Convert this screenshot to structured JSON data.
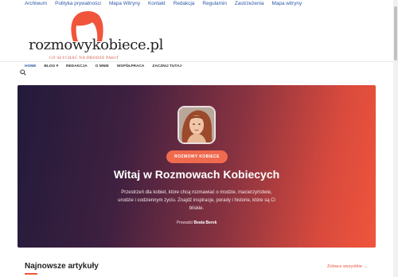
{
  "topbar": {
    "links": [
      "Archiwum",
      "Polityka prywatności",
      "Mapa Witryny",
      "Kontakt",
      "Redakcja",
      "Regulamin",
      "Zastrzeżenia",
      "Mapa witryny"
    ]
  },
  "logo": {
    "name": "rozmowykobiece.pl",
    "tagline": "CO SŁYCHAĆ NA DRODZE PAKIT"
  },
  "nav": {
    "items": [
      "HOME",
      "BLOG ▾",
      "REDAKCJA",
      "O MNIE",
      "WSPÓŁPRACA",
      "ZACZNIJ TUTAJ"
    ],
    "search_icon": "search-icon"
  },
  "hero": {
    "badge": "ROZMOWY KOBIECE",
    "title": "Witaj w Rozmowach Kobiecych",
    "description": "Przestrzeń dla kobiet, które chcą rozmawiać o modzie, macierzyństwie, urodzie i codziennym życiu. Znajdź inspiracje, porady i historie, które są Ci bliskie.",
    "author_prefix": "Prowadzi",
    "author_name": "Beata Berek"
  },
  "latest": {
    "title": "Najnowsze artykuły",
    "see_all": "Zobacz wszystkie →"
  },
  "colors": {
    "accent": "#f0553c",
    "link": "#2b59a8",
    "hero_dark": "#221a3a"
  }
}
